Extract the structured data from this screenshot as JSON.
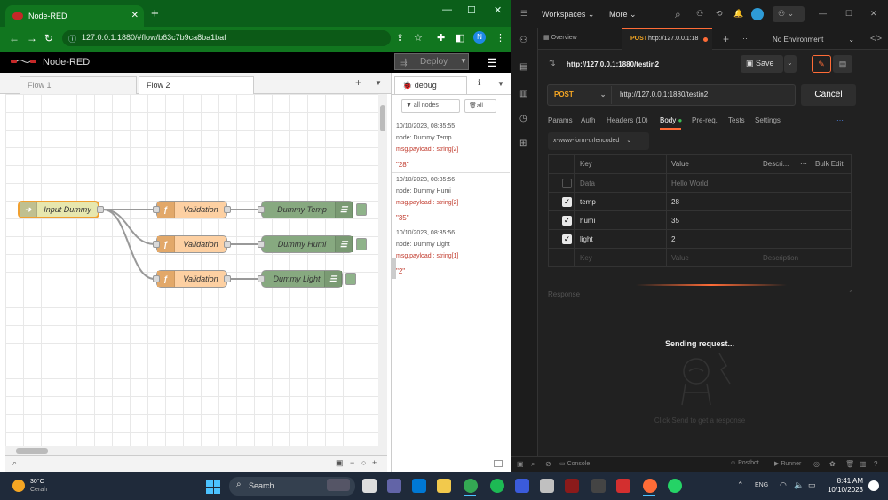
{
  "chrome": {
    "tab_title": "Node-RED",
    "url": "127.0.0.1:1880/#flow/b63c7b9ca8ba1baf",
    "profile": "N"
  },
  "nodered": {
    "app_title": "Node-RED",
    "deploy_label": "Deploy",
    "tabs": [
      "Flow 1",
      "Flow 2"
    ],
    "nodes": {
      "inject": "Input Dummy",
      "function1": "Validation",
      "function2": "Validation",
      "function3": "Validation",
      "debug1": "Dummy Temp",
      "debug2": "Dummy Humi",
      "debug3": "Dummy Light"
    },
    "sidebar_tab": "debug",
    "filter_nodes": "all nodes",
    "filter_all": "all",
    "debug_messages": [
      {
        "time": "10/10/2023, 08:35:55",
        "node": "node: Dummy Temp",
        "type": "msg.payload : string[2]",
        "value": "\"28\""
      },
      {
        "time": "10/10/2023, 08:35:56",
        "node": "node: Dummy Humi",
        "type": "msg.payload : string[2]",
        "value": "\"35\""
      },
      {
        "time": "10/10/2023, 08:35:56",
        "node": "node: Dummy Light",
        "type": "msg.payload : string[1]",
        "value": "\"2\""
      }
    ]
  },
  "postman": {
    "workspaces": "Workspaces",
    "more": "More",
    "overview": "Overview",
    "active_tab_method": "POST",
    "active_tab_url": "http://127.0.0.1:18",
    "no_env": "No Environment",
    "request_title": "http://127.0.0.1:1880/testin2",
    "save": "Save",
    "method": "POST",
    "url": "http://127.0.0.1:1880/testin2",
    "send": "Cancel",
    "subtabs": [
      "Params",
      "Auth",
      "Headers (10)",
      "Body",
      "Pre-req.",
      "Tests",
      "Settings"
    ],
    "encoding": "x-www-form-urlencoded",
    "columns": {
      "key": "Key",
      "value": "Value",
      "desc": "Descri...",
      "bulk": "Bulk Edit"
    },
    "rows": [
      {
        "key": "Data",
        "value": "Hello World",
        "checked": false
      },
      {
        "key": "temp",
        "value": "28",
        "checked": true
      },
      {
        "key": "humi",
        "value": "35",
        "checked": true
      },
      {
        "key": "light",
        "value": "2",
        "checked": true
      }
    ],
    "placeholder": {
      "key": "Key",
      "value": "Value",
      "desc": "Description"
    },
    "response": "Response",
    "sending": "Sending request...",
    "hint": "Click Send to get a response",
    "footer": {
      "console": "Console",
      "postbot": "Postbot",
      "runner": "Runner"
    }
  },
  "taskbar": {
    "temp": "30°C",
    "weather": "Cerah",
    "search": "Search",
    "lang": "ENG",
    "time": "8:41 AM",
    "date": "10/10/2023"
  }
}
